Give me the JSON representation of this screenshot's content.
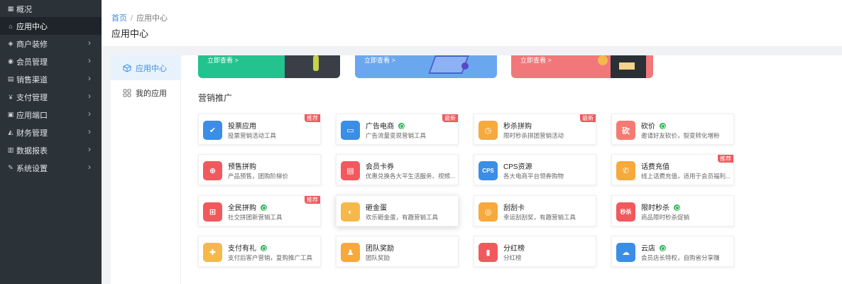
{
  "sidebar": {
    "items": [
      {
        "label": "概况",
        "icon": "overview-icon",
        "glyph": "▦",
        "chevron": false
      },
      {
        "label": "应用中心",
        "icon": "home-icon",
        "glyph": "⌂",
        "chevron": false,
        "active": true
      },
      {
        "label": "商户装修",
        "icon": "palette-icon",
        "glyph": "◈",
        "chevron": true
      },
      {
        "label": "会员管理",
        "icon": "users-icon",
        "glyph": "◉",
        "chevron": true
      },
      {
        "label": "销售渠道",
        "icon": "channel-icon",
        "glyph": "▤",
        "chevron": true
      },
      {
        "label": "支付管理",
        "icon": "yen-icon",
        "glyph": "¥",
        "chevron": true
      },
      {
        "label": "应用端口",
        "icon": "port-icon",
        "glyph": "▣",
        "chevron": true
      },
      {
        "label": "财务管理",
        "icon": "chart-icon",
        "glyph": "◭",
        "chevron": true
      },
      {
        "label": "数据报表",
        "icon": "report-icon",
        "glyph": "▥",
        "chevron": true
      },
      {
        "label": "系统设置",
        "icon": "wrench-icon",
        "glyph": "✎",
        "chevron": true
      }
    ]
  },
  "header": {
    "breadcrumb_home": "首页",
    "breadcrumb_sep": "/",
    "breadcrumb_current": "应用中心",
    "title": "应用中心"
  },
  "subnav": {
    "items": [
      {
        "label": "应用中心",
        "icon": "cube-icon",
        "active": true
      },
      {
        "label": "我的应用",
        "icon": "grid-icon",
        "active": false
      }
    ]
  },
  "banners": [
    {
      "link": "立即查看 >",
      "color": "#22c38e"
    },
    {
      "link": "立即查看 >",
      "color": "#6aa7ef"
    },
    {
      "link": "立即查看 >",
      "color": "#f1777a"
    }
  ],
  "section": {
    "title": "营销推广"
  },
  "cards": [
    {
      "name": "投票应用",
      "desc": "投票营销活动工具",
      "color": "#3a8ee6",
      "glyph": "✔",
      "icon": "vote-icon",
      "verified": false,
      "tag": "推荐"
    },
    {
      "name": "广告电商",
      "desc": "广告流量变现营销工具",
      "color": "#3a8ee6",
      "glyph": "▭",
      "icon": "screen-icon",
      "verified": true,
      "tag": "最新"
    },
    {
      "name": "秒杀拼购",
      "desc": "限时秒杀拼团营销活动",
      "color": "#f7a93b",
      "glyph": "◷",
      "icon": "alarm-icon",
      "verified": false,
      "tag": "最新"
    },
    {
      "name": "砍价",
      "desc": "邀请好友砍价，裂变转化增粉",
      "color": "#f57a72",
      "glyph": "砍",
      "icon": "bargain-icon",
      "verified": true,
      "tag": ""
    },
    {
      "name": "预售拼购",
      "desc": "产品预售，团购阶梯价",
      "color": "#f1595d",
      "glyph": "⊕",
      "icon": "presale-icon",
      "verified": false,
      "tag": ""
    },
    {
      "name": "会员卡券",
      "desc": "优惠兑换各大平生活服务、视频...",
      "color": "#f1595d",
      "glyph": "▤",
      "icon": "card-icon",
      "verified": false,
      "tag": ""
    },
    {
      "name": "CPS资源",
      "desc": "各大电商平台领券购物",
      "color": "#3a8ee6",
      "glyph": "CPS",
      "icon": "cps-icon",
      "verified": false,
      "tag": ""
    },
    {
      "name": "话费充值",
      "desc": "线上话费充值，适用于会员福利...",
      "color": "#f7a93b",
      "glyph": "✆",
      "icon": "phone-icon",
      "verified": false,
      "tag": "推荐"
    },
    {
      "name": "全民拼购",
      "desc": "社交拼团新营销工具",
      "color": "#f1595d",
      "glyph": "⊞",
      "icon": "bag-icon",
      "verified": true,
      "tag": "推荐"
    },
    {
      "name": "砸金蛋",
      "desc": "欢乐砸金蛋，有趣营销工具",
      "color": "#f7b84b",
      "glyph": "◐",
      "icon": "egg-icon",
      "verified": false,
      "tag": "",
      "hover": true
    },
    {
      "name": "刮刮卡",
      "desc": "幸运刮刮奖，有趣营销工具",
      "color": "#f7a93b",
      "glyph": "◎",
      "icon": "scratch-icon",
      "verified": false,
      "tag": ""
    },
    {
      "name": "限时秒杀",
      "desc": "商品限时秒杀促销",
      "color": "#f1595d",
      "glyph": "秒杀",
      "icon": "flash-sale-icon",
      "verified": true,
      "tag": ""
    },
    {
      "name": "支付有礼",
      "desc": "支付后客户营销，复购推广工具",
      "color": "#f7b84b",
      "glyph": "✚",
      "icon": "gift-icon",
      "verified": true,
      "tag": ""
    },
    {
      "name": "团队奖励",
      "desc": "团队奖励",
      "color": "#f7a93b",
      "glyph": "♟",
      "icon": "team-icon",
      "verified": false,
      "tag": ""
    },
    {
      "name": "分红榜",
      "desc": "分红榜",
      "color": "#f1595d",
      "glyph": "▮",
      "icon": "bar-chart-icon",
      "verified": false,
      "tag": ""
    },
    {
      "name": "云店",
      "desc": "会员店长特权，自购省分享赚",
      "color": "#3a8ee6",
      "glyph": "☁",
      "icon": "cloud-icon",
      "verified": true,
      "tag": ""
    }
  ]
}
